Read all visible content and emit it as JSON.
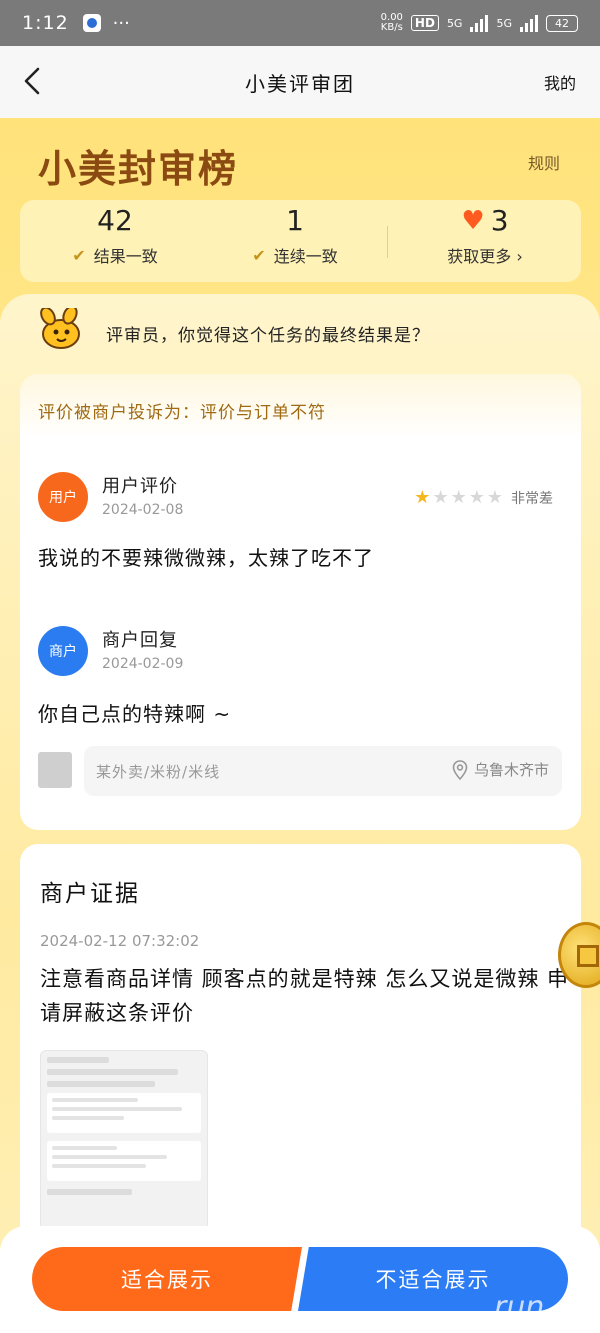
{
  "status_bar": {
    "time": "1:12",
    "more": "···",
    "net_speed_value": "0.00",
    "net_speed_unit": "KB/s",
    "hd_label": "HD",
    "signal1": "5G",
    "signal2": "5G",
    "battery": "42"
  },
  "nav": {
    "title": "小美评审团",
    "mine": "我的"
  },
  "header": {
    "brand": "小美封审榜",
    "rules": "规则"
  },
  "stats": {
    "consistent_count": "42",
    "consistent_label": "结果一致",
    "streak_count": "1",
    "streak_label": "连续一致",
    "hearts": "3",
    "get_more": "获取更多 ›"
  },
  "question": "评审员，你觉得这个任务的最终结果是？",
  "case": {
    "complaint": "评价被商户投诉为：评价与订单不符",
    "user_badge": "用户",
    "user_title": "用户评价",
    "user_date": "2024-02-08",
    "rating_text": "非常差",
    "rating": 1,
    "rating_max": 5,
    "user_review": "我说的不要辣微微辣，太辣了吃不了",
    "merchant_badge": "商户",
    "merchant_title": "商户回复",
    "merchant_date": "2024-02-09",
    "merchant_reply": "你自己点的特辣啊 ~",
    "store_name": "某外卖/米粉/米线",
    "city": "乌鲁木齐市"
  },
  "evidence": {
    "title": "商户证据",
    "time": "2024-02-12 07:32:02",
    "text": "注意看商品详情 顾客点的就是特辣 怎么又说是微辣 申请屏蔽这条评价"
  },
  "actions": {
    "approve": "适合展示",
    "reject": "不适合展示"
  },
  "watermark": "run",
  "colors": {
    "accent_orange": "#ff6a1a",
    "accent_blue": "#2b7cf5",
    "brand_brown": "#8a4a12",
    "header_yellow": "#ffe27a"
  }
}
